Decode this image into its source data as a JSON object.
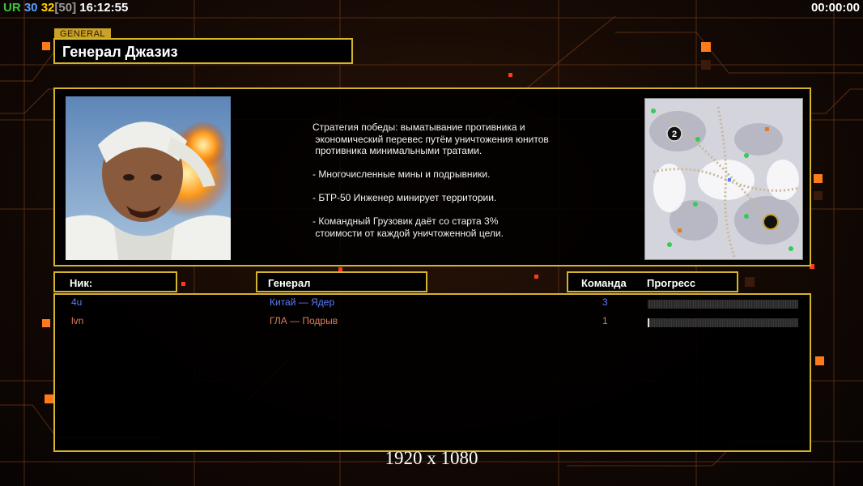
{
  "hud": {
    "ur": "UR",
    "fps": "30",
    "players": "32",
    "max": "[50]",
    "clock": "16:12:55",
    "game_timer": "00:00:00"
  },
  "general_tag": "GENERAL",
  "general_title": "Генерал Джазиз",
  "description": [
    "Стратегия победы: выматывание противника и\n экономический перевес путём уничтожения юнитов\n противника минимальными тратами.",
    "- Многочисленные мины и подрывники.",
    "- БТР-50 Инженер минирует территории.",
    "- Командный Грузовик даёт со старта 3%\n стоимости от каждой уничтоженной цели."
  ],
  "headers": {
    "nick": "Ник:",
    "general": "Генерал",
    "team": "Команда",
    "progress": "Прогресс"
  },
  "players": [
    {
      "nick": "4u",
      "general": "Китай — Ядер",
      "team": "3",
      "progress": 0,
      "color": "#5a7cff"
    },
    {
      "nick": "lvn",
      "general": "ГЛА — Подрыв",
      "team": "1",
      "progress": 0.01,
      "color": "#e07a5a"
    }
  ],
  "resolution_label": "1920 x 1080",
  "colors": {
    "accent_gold": "#d4b42a"
  }
}
